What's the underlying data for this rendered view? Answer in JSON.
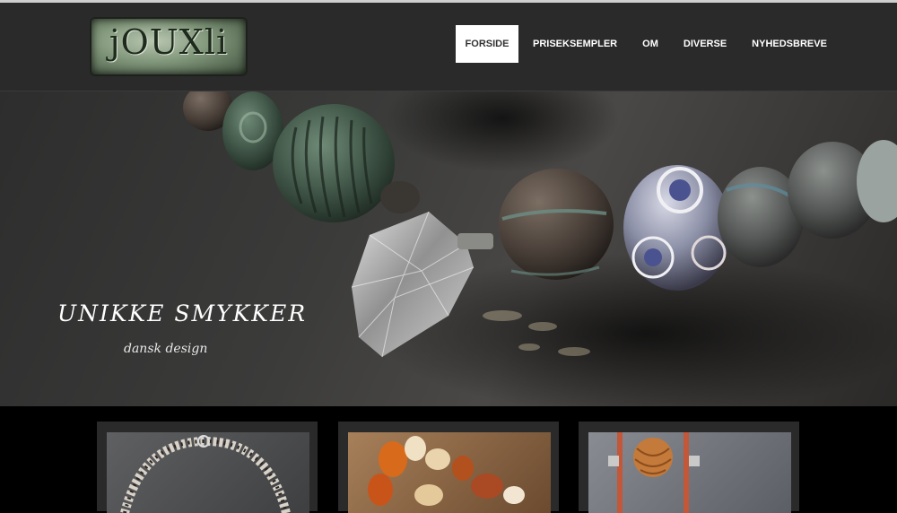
{
  "logo": {
    "text": "jOUXli"
  },
  "nav": {
    "items": [
      {
        "label": "FORSIDE",
        "active": true
      },
      {
        "label": "PRISEKSEMPLER",
        "active": false
      },
      {
        "label": "OM",
        "active": false
      },
      {
        "label": "DIVERSE",
        "active": false
      },
      {
        "label": "NYHEDSBREVE",
        "active": false
      }
    ]
  },
  "hero": {
    "title": "UNIKKE SMYKKER",
    "subtitle": "dansk design"
  },
  "colors": {
    "header_bg": "#2b2a2b",
    "active_nav_bg": "#ffffff",
    "page_bg": "#000000"
  }
}
